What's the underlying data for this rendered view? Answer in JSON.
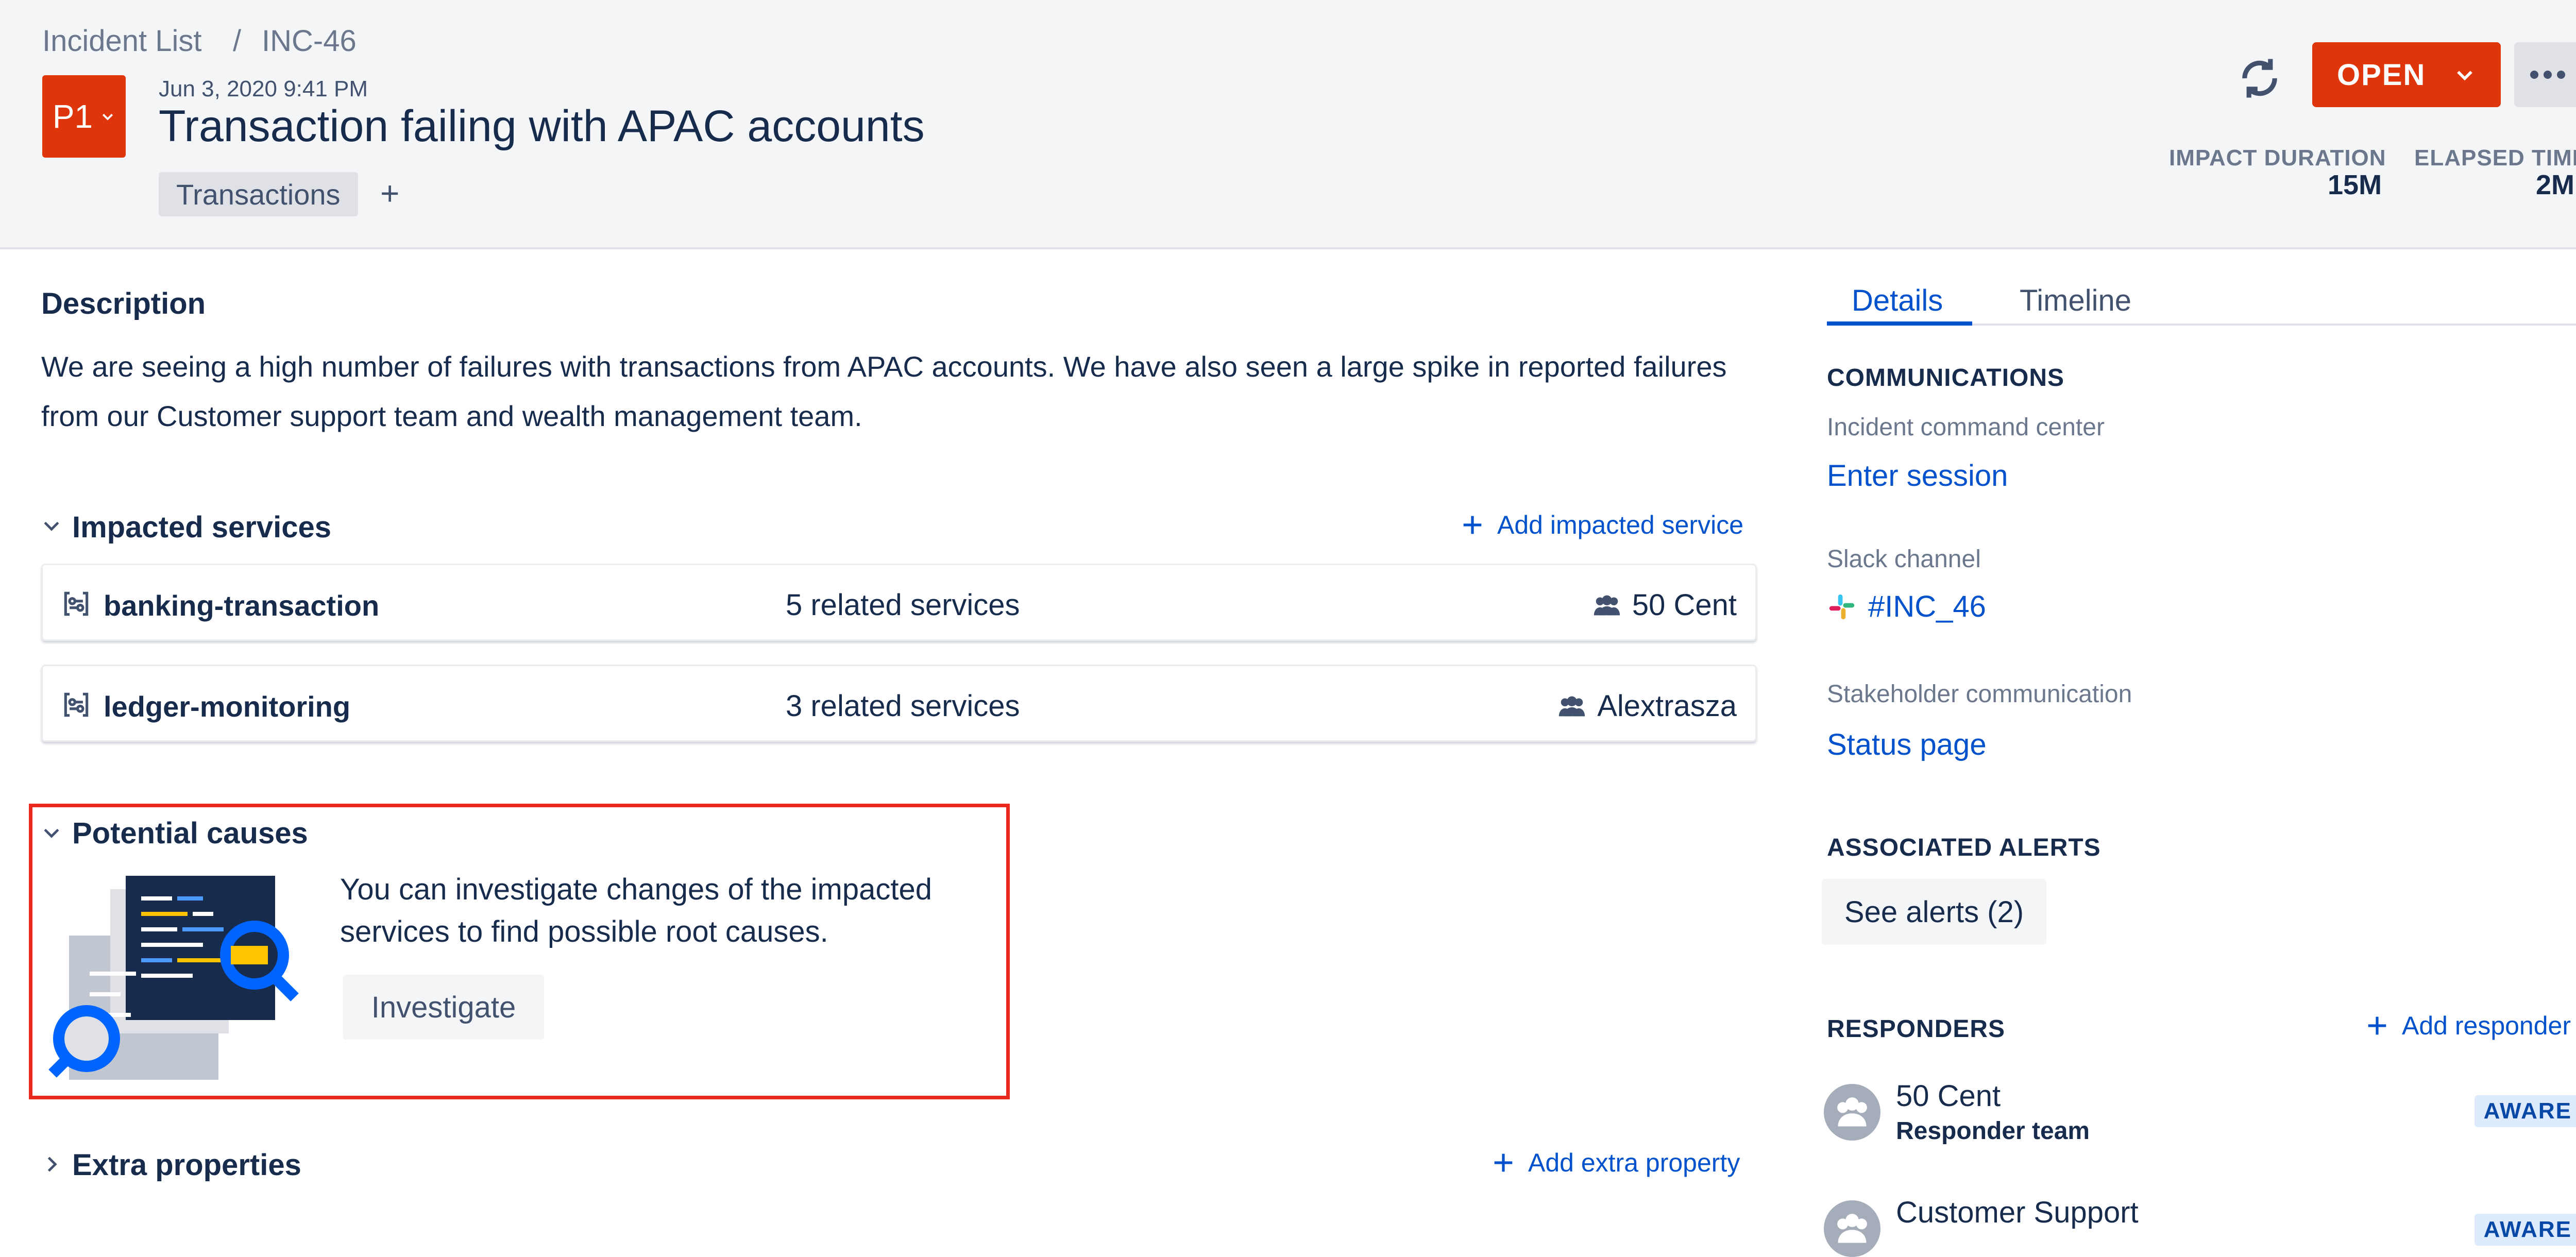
{
  "breadcrumb": {
    "parent": "Incident List",
    "separator": "/",
    "current": "INC-46"
  },
  "incident": {
    "priority": "P1",
    "date": "Jun 3, 2020 9:41 PM",
    "title": "Transaction failing with APAC accounts",
    "tag": "Transactions",
    "tag_add": "+",
    "status": "OPEN"
  },
  "stats": {
    "impact_label": "IMPACT DURATION",
    "impact_value": "15M",
    "elapsed_label": "ELAPSED TIME",
    "elapsed_value": "2M"
  },
  "description": {
    "heading": "Description",
    "text": "We are seeing a high number of failures with transactions from APAC accounts. We have also seen a large spike in reported failures from our Customer support team and wealth management team."
  },
  "impacted": {
    "heading": "Impacted services",
    "add_label": "Add impacted service",
    "services": [
      {
        "name": "banking-transaction",
        "related": "5 related services",
        "owner": "50 Cent"
      },
      {
        "name": "ledger-monitoring",
        "related": "3 related services",
        "owner": "Alextrasza"
      }
    ]
  },
  "causes": {
    "heading": "Potential causes",
    "text": "You can investigate changes of the impacted services to find possible root causes.",
    "button": "Investigate"
  },
  "extra": {
    "heading": "Extra properties",
    "add_label": "Add extra property"
  },
  "tabs": {
    "details": "Details",
    "timeline": "Timeline"
  },
  "communications": {
    "heading": "COMMUNICATIONS",
    "command_label": "Incident command center",
    "command_link": "Enter session",
    "slack_label": "Slack channel",
    "slack_link": "#INC_46",
    "stakeholder_label": "Stakeholder communication",
    "stakeholder_link": "Status page"
  },
  "alerts": {
    "heading": "ASSOCIATED ALERTS",
    "button": "See alerts (2)"
  },
  "responders": {
    "heading": "RESPONDERS",
    "add_label": "Add responder",
    "items": [
      {
        "name": "50 Cent",
        "role": "Responder team",
        "status": "AWARE"
      },
      {
        "name": "Customer Support",
        "status": "AWARE"
      }
    ]
  },
  "colors": {
    "accent": "#0052CC",
    "danger": "#DE350B",
    "highlight": "#E8291C"
  }
}
